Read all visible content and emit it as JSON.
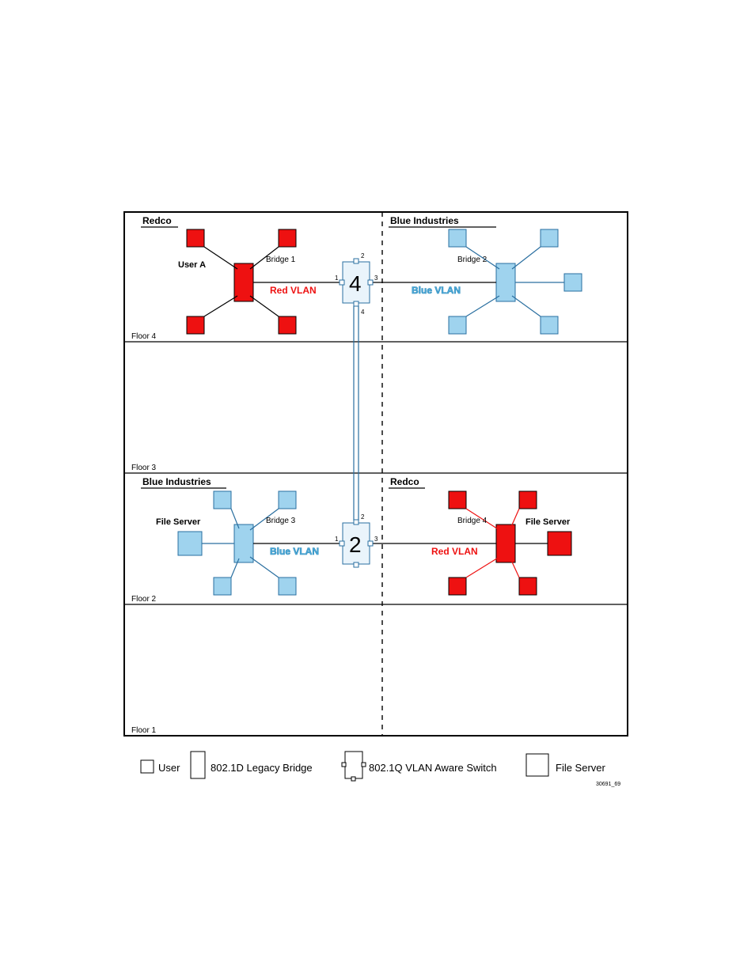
{
  "rooms": {
    "f4_left": "Redco",
    "f4_right": "Blue Industries",
    "f2_left": "Blue Industries",
    "f2_right": "Redco"
  },
  "floors": {
    "f4": "Floor 4",
    "f3": "Floor 3",
    "f2": "Floor 2",
    "f1": "Floor 1"
  },
  "labels": {
    "userA": "User A",
    "bridge1": "Bridge 1",
    "bridge2": "Bridge 2",
    "bridge3": "Bridge 3",
    "bridge4": "Bridge 4",
    "fileServerL": "File Server",
    "fileServerR": "File Server",
    "redVlan": "Red VLAN",
    "blueVlan": "Blue VLAN"
  },
  "switches": {
    "sw4": {
      "num": "4",
      "ports": {
        "p1": "1",
        "p2": "2",
        "p3": "3",
        "p4": "4"
      }
    },
    "sw2": {
      "num": "2",
      "ports": {
        "p1": "1",
        "p2": "2",
        "p3": "3"
      }
    }
  },
  "legend": {
    "user": "User",
    "legacy": "802.1D Legacy Bridge",
    "vlanSwitch": "802.1Q VLAN Aware Switch",
    "fileServer": "File Server"
  },
  "figId": "30691_69"
}
